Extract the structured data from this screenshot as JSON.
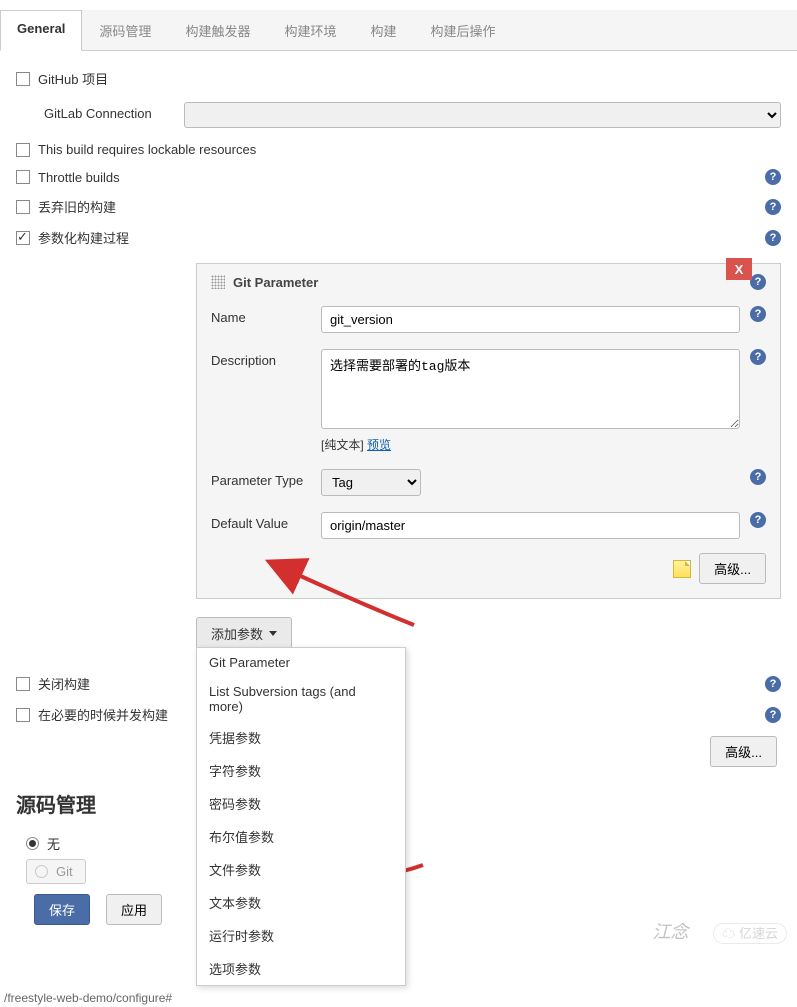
{
  "tabs": [
    "General",
    "源码管理",
    "构建触发器",
    "构建环境",
    "构建",
    "构建后操作"
  ],
  "general": {
    "github_project": "GitHub 项目",
    "gitlab_connection_label": "GitLab Connection",
    "lockable_resources": "This build requires lockable resources",
    "throttle_builds": "Throttle builds",
    "discard_old": "丢弃旧的构建",
    "parameterized": "参数化构建过程",
    "close_build": "关闭构建",
    "concurrent_build": "在必要的时候并发构建"
  },
  "git_param": {
    "panel_title": "Git Parameter",
    "close": "X",
    "name_label": "Name",
    "name_value": "git_version",
    "desc_label": "Description",
    "desc_value": "选择需要部署的tag版本",
    "plain_text": "[纯文本]",
    "preview": "预览",
    "type_label": "Parameter Type",
    "type_value": "Tag",
    "default_label": "Default Value",
    "default_value": "origin/master",
    "advanced": "高级..."
  },
  "add_param_button": "添加参数",
  "param_menu": [
    "Git Parameter",
    "List Subversion tags (and more)",
    "凭据参数",
    "字符参数",
    "密码参数",
    "布尔值参数",
    "文件参数",
    "文本参数",
    "运行时参数",
    "选项参数"
  ],
  "advanced_btn": "高级...",
  "scm_section": "源码管理",
  "scm_none": "无",
  "scm_git": "Git",
  "save": "保存",
  "apply": "应用",
  "url": "/freestyle-web-demo/configure#",
  "watermark_left": "江念",
  "watermark_right": "亿速云"
}
